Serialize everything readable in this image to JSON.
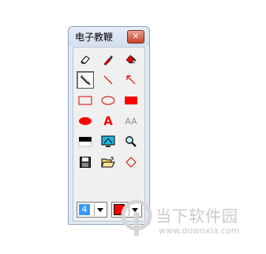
{
  "window": {
    "title": "电子教鞭",
    "close_label": "✕"
  },
  "toolbar": {
    "tools": [
      {
        "id": "eraser",
        "icon": "eraser-icon"
      },
      {
        "id": "marker",
        "icon": "marker-icon"
      },
      {
        "id": "clear",
        "icon": "clear-icon"
      },
      {
        "id": "pen",
        "icon": "pen-icon",
        "selected": true
      },
      {
        "id": "line",
        "icon": "line-icon"
      },
      {
        "id": "arrow",
        "icon": "arrow-icon"
      },
      {
        "id": "rectangle",
        "icon": "rectangle-icon"
      },
      {
        "id": "ellipse",
        "icon": "ellipse-icon"
      },
      {
        "id": "filled-rectangle",
        "icon": "filled-rectangle-icon"
      },
      {
        "id": "filled-ellipse",
        "icon": "filled-ellipse-icon"
      },
      {
        "id": "text",
        "icon": "text-icon"
      },
      {
        "id": "font",
        "icon": "font-icon"
      },
      {
        "id": "background",
        "icon": "background-icon"
      },
      {
        "id": "screen",
        "icon": "screen-icon"
      },
      {
        "id": "zoom",
        "icon": "zoom-icon"
      },
      {
        "id": "save",
        "icon": "save-icon"
      },
      {
        "id": "open",
        "icon": "open-folder-icon"
      },
      {
        "id": "diamond",
        "icon": "diamond-icon"
      }
    ],
    "text_glyph": "A",
    "font_glyph": "AA"
  },
  "controls": {
    "line_width_value": "4",
    "color_value": "#ff0000"
  },
  "watermark": {
    "text": "当下软件园",
    "url": "www.downxia.com"
  }
}
